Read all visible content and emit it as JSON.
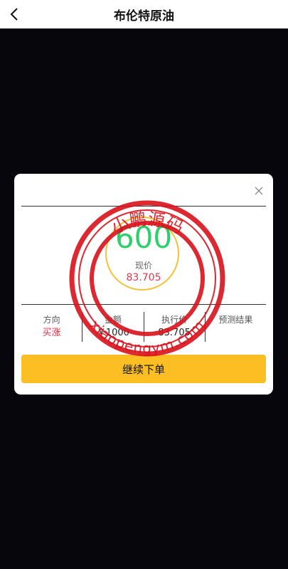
{
  "header": {
    "title": "布伦特原油",
    "back_icon": "chevron-left-icon"
  },
  "dialog": {
    "close_icon": "close-icon",
    "countdown": "600",
    "current_price_label": "现价",
    "current_price_value": "83.705",
    "columns": [
      {
        "label": "方向",
        "value": "买涨"
      },
      {
        "label": "金额",
        "value": "￥1000"
      },
      {
        "label": "执行价",
        "value": "83.705"
      },
      {
        "label": "预测结果",
        "value": ""
      }
    ],
    "continue_button": "继续下单"
  },
  "watermark": {
    "top_text": "小鹏源码",
    "bottom_text": "xiaopengym.com"
  },
  "colors": {
    "background": "#07060d",
    "accent": "#fbbf23",
    "countdown": "#2dcf6a",
    "price_red": "#e0394b",
    "ring": "#f4c237",
    "watermark": "#d8111b"
  }
}
